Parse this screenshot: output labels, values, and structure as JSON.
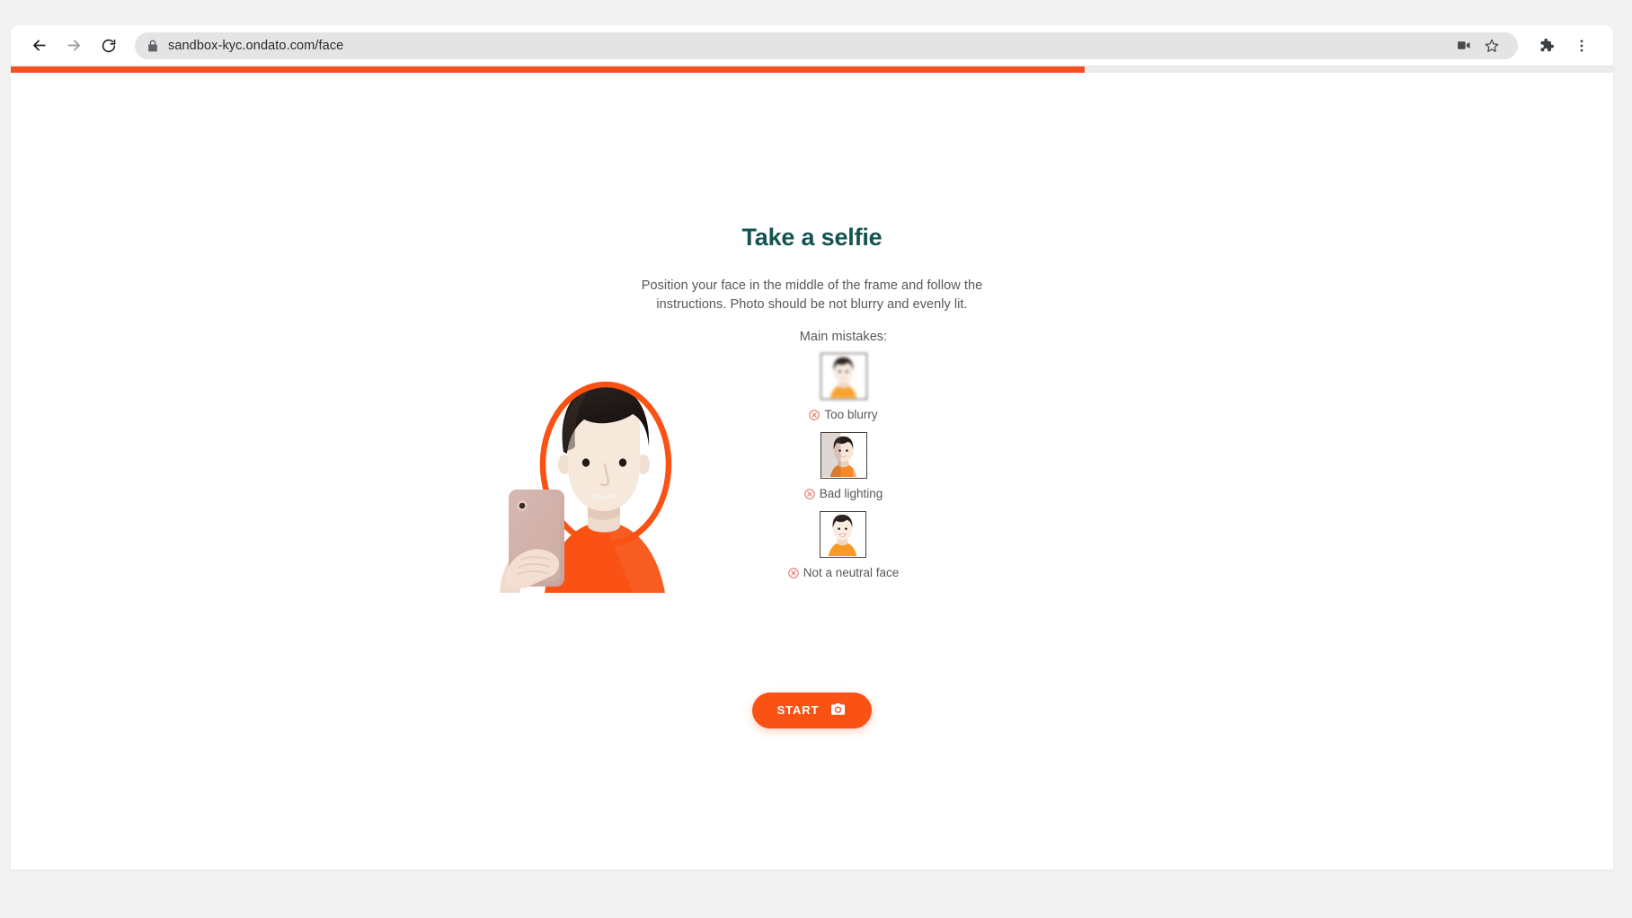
{
  "browser": {
    "back_icon": "arrow-left-icon",
    "forward_icon": "arrow-right-icon",
    "reload_icon": "reload-icon",
    "lock_icon": "lock-icon",
    "url": "sandbox-kyc.ondato.com/face",
    "media_icon": "video-camera-icon",
    "bookmark_icon": "star-icon",
    "extensions_icon": "puzzle-piece-icon",
    "menu_icon": "three-dot-menu-icon"
  },
  "page": {
    "progress_percent": 67,
    "progress_color": "#f4511e",
    "title": "Take a selfie",
    "title_color": "#145450",
    "subtitle": "Position your face in the middle of the frame and follow the instructions. Photo should be not blurry and evenly lit.",
    "illustration_name": "person-taking-selfie-illustration",
    "accent_color": "#fa5115",
    "mistakes": {
      "label": "Main mistakes:",
      "error_icon": "circle-x-icon",
      "error_icon_color": "#e8776b",
      "items": [
        {
          "caption": "Too blurry",
          "thumb_name": "mistake-thumb-too-blurry"
        },
        {
          "caption": "Bad lighting",
          "thumb_name": "mistake-thumb-bad-lighting"
        },
        {
          "caption": "Not a neutral face",
          "thumb_name": "mistake-thumb-not-neutral-face"
        }
      ]
    },
    "start_button": {
      "label": "START",
      "icon": "camera-icon"
    }
  }
}
